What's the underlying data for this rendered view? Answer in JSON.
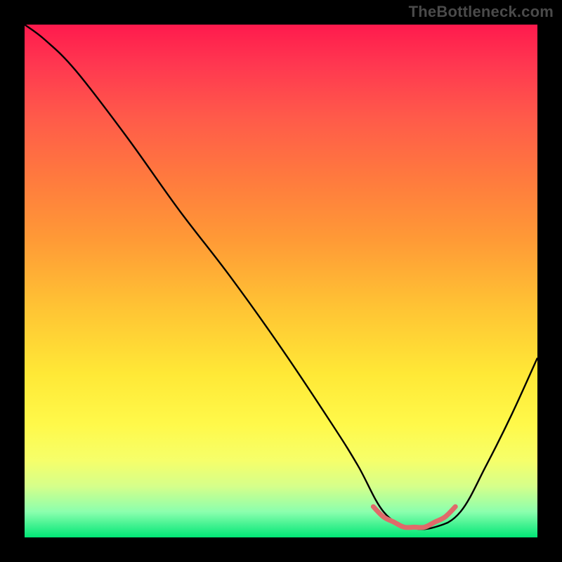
{
  "watermark": "TheBottleneck.com",
  "chart_data": {
    "type": "line",
    "title": "",
    "xlabel": "",
    "ylabel": "",
    "xlim": [
      0,
      100
    ],
    "ylim": [
      0,
      100
    ],
    "note": "Heat-map gradient background (red=high, green=low) with a black bottleneck curve. The curve descends from high at the far left to near-zero around x≈70–80 (flat trough) then rises toward the right edge. A short salmon segment highlights the trough.",
    "series": [
      {
        "name": "bottleneck_curve",
        "color": "#000000",
        "x": [
          0,
          4,
          10,
          20,
          30,
          40,
          50,
          60,
          65,
          70,
          75,
          80,
          85,
          90,
          95,
          100
        ],
        "values": [
          100,
          97,
          91,
          78,
          64,
          51,
          37,
          22,
          14,
          5,
          2,
          2,
          5,
          14,
          24,
          35
        ]
      },
      {
        "name": "optimal_range_highlight",
        "color": "#e06a6a",
        "x": [
          68,
          70,
          72,
          74,
          76,
          78,
          80,
          82,
          84
        ],
        "values": [
          6,
          4,
          3,
          2,
          2,
          2,
          3,
          4,
          6
        ]
      }
    ],
    "background_gradient_stops": [
      {
        "pos": 0.0,
        "color": "#ff1a4d"
      },
      {
        "pos": 0.5,
        "color": "#ffc334"
      },
      {
        "pos": 0.8,
        "color": "#fff94a"
      },
      {
        "pos": 1.0,
        "color": "#00e676"
      }
    ]
  }
}
